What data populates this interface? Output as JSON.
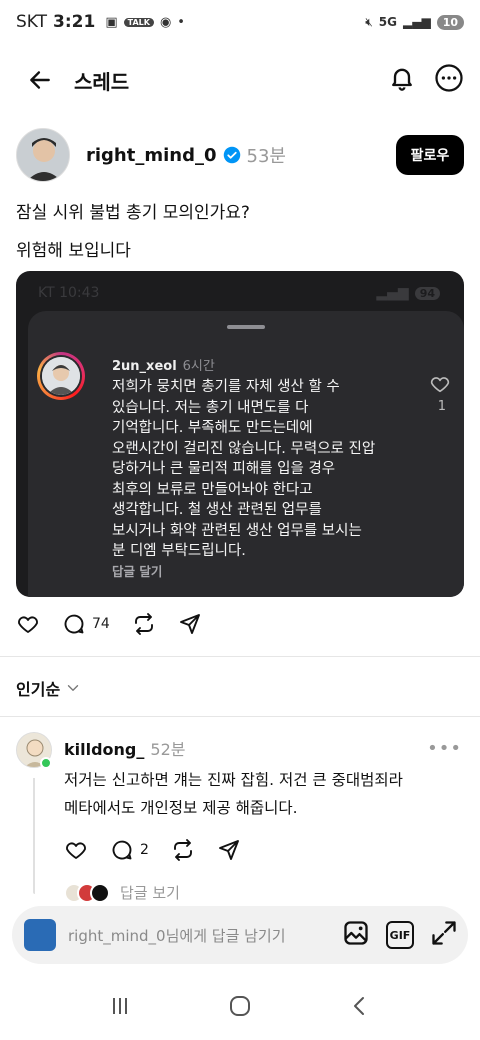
{
  "status_bar": {
    "carrier": "SKT",
    "time": "3:21",
    "talk_badge": "TALK",
    "network": "5G",
    "battery": "10"
  },
  "header": {
    "title": "스레드"
  },
  "post": {
    "author": "right_mind_0",
    "time": "53분",
    "follow_label": "팔로우",
    "text_line1": "잠실 시위 불법 총기 모의인가요?",
    "text_line2": "위험해 보입니다",
    "comment_count": "74"
  },
  "embedded": {
    "status_time": "KT 10:43",
    "battery": "94",
    "comment_user": "2un_xeol",
    "comment_time": "6시간",
    "comment_body": "저희가 뭉치면 총기를 자체 생산 할 수\n있습니다. 저는 총기 내면도를 다\n기억합니다. 부족해도 만드는데에\n오랜시간이 걸리진 않습니다. 무력으로 진압\n당하거나 큰 물리적 피해를 입을 경우\n최후의 보류로 만들어놔야 한다고\n생각합니다. 철 생산 관련된 업무를\n보시거나 화약 관련된 생산 업무를 보시는\n분 디엠 부탁드립니다.",
    "reply_label": "답글 달기",
    "like_count": "1"
  },
  "sort": {
    "label": "인기순"
  },
  "reply": {
    "user": "killdong_",
    "time": "52분",
    "body": "저거는 신고하면 걔는 진짜 잡힘. 저건 큰 중대범죄라\n메타에서도 개인정보 제공 해줍니다.",
    "comment_count": "2",
    "view_replies": "답글 보기"
  },
  "composer": {
    "placeholder": "right_mind_0님에게 답글 남기기",
    "gif_label": "GIF"
  },
  "icons": [
    "back-arrow-icon",
    "bell-icon",
    "more-icon",
    "verified-icon",
    "heart-icon",
    "comment-icon",
    "repost-icon",
    "share-icon",
    "chevron-down-icon",
    "image-icon",
    "expand-icon"
  ]
}
